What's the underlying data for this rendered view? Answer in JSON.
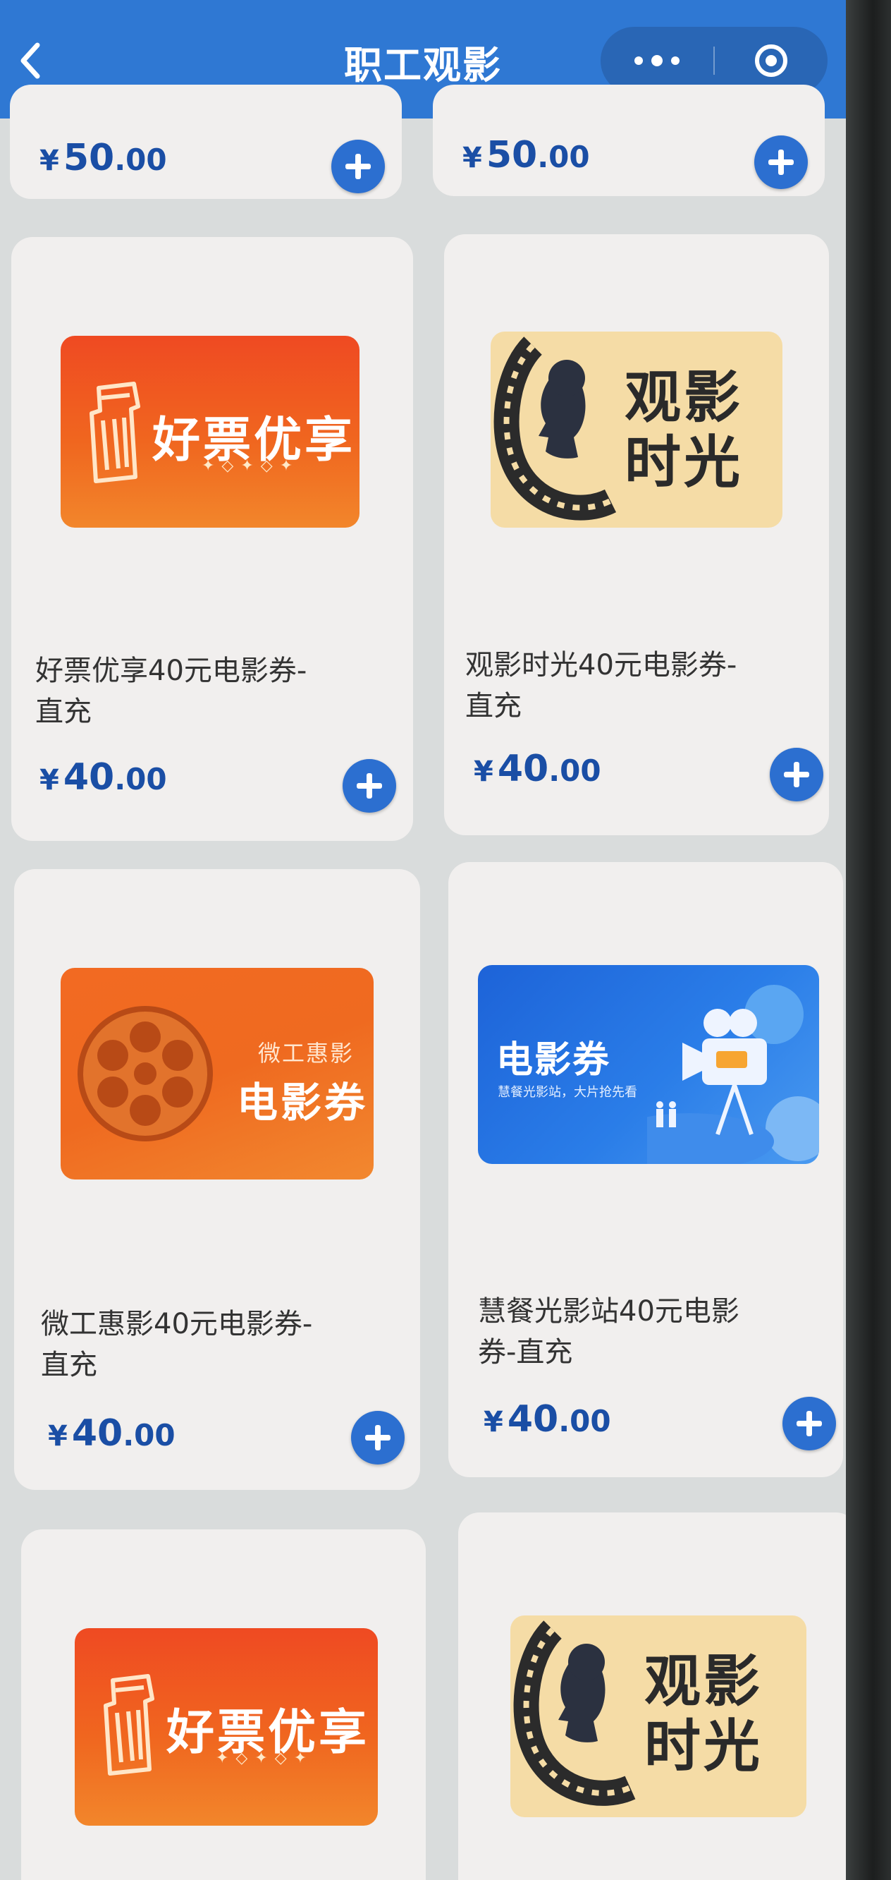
{
  "header": {
    "title": "职工观影",
    "back_icon": "chevron-left-icon",
    "menu_icon": "more-dots-icon",
    "close_icon": "target-circle-icon",
    "bg_color": "#2f78d3"
  },
  "colors": {
    "price": "#1a4ea5",
    "add_button": "#2c6fd0",
    "card_bg": "#f1efee"
  },
  "products": [
    {
      "name": "",
      "price_currency": "¥",
      "price_int": "50",
      "price_dec": ".00",
      "thumbnail": "none"
    },
    {
      "name": "",
      "price_currency": "¥",
      "price_int": "50",
      "price_dec": ".00",
      "thumbnail": "none"
    },
    {
      "name_line1": "好票优享40元电影券-",
      "name_line2": "直充",
      "price_currency": "¥",
      "price_int": "40",
      "price_dec": ".00",
      "thumbnail": "haopiao",
      "thumb_text": "好票优享",
      "thumb_stars": "✦◇✦◇✦"
    },
    {
      "name_line1": "观影时光40元电影券-",
      "name_line2": "直充",
      "price_currency": "¥",
      "price_int": "40",
      "price_dec": ".00",
      "thumbnail": "guanying",
      "thumb_line1": "观影",
      "thumb_line2": "时光"
    },
    {
      "name_line1": "微工惠影40元电影券-",
      "name_line2": "直充",
      "price_currency": "¥",
      "price_int": "40",
      "price_dec": ".00",
      "thumbnail": "weigong",
      "thumb_small": "微工惠影",
      "thumb_big": "电影券"
    },
    {
      "name_line1": "慧餐光影站40元电影",
      "name_line2": "券-直充",
      "price_currency": "¥",
      "price_int": "40",
      "price_dec": ".00",
      "thumbnail": "dianying",
      "thumb_title": "电影券",
      "thumb_sub": "慧餐光影站，大片抢先看"
    },
    {
      "thumbnail": "haopiao",
      "thumb_text": "好票优享",
      "thumb_stars": "✦◇✦◇✦"
    },
    {
      "thumbnail": "guanying",
      "thumb_line1": "观影",
      "thumb_line2": "时光"
    }
  ]
}
